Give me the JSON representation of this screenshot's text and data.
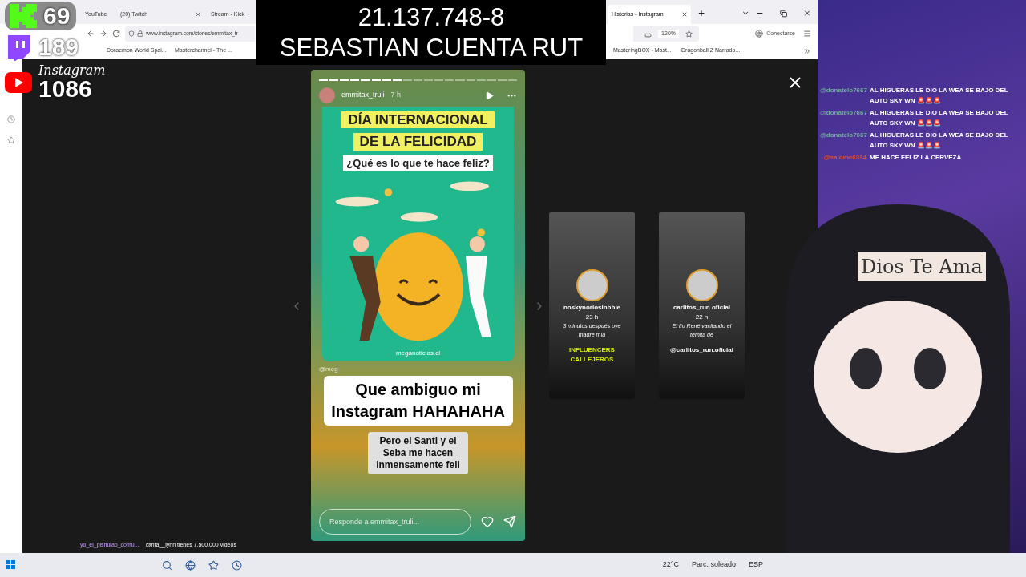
{
  "overlay": {
    "rut": "21.137.748-8",
    "title": "SEBASTIAN CUENTA RUT"
  },
  "counters": [
    {
      "kind": "kick",
      "value": "69"
    },
    {
      "kind": "twitch",
      "value": "189"
    },
    {
      "kind": "youtube",
      "label": "Instagram",
      "value": "1086"
    }
  ],
  "browser": {
    "tabs": [
      {
        "label": "YouTube",
        "selected": false
      },
      {
        "label": "(20) Twitch",
        "selected": false
      },
      {
        "label": "Stream - Kick",
        "selected": false
      },
      {
        "label": "Historias • Instagram",
        "selected": true
      }
    ],
    "url": "www.instagram.com/stories/emmitax_tr",
    "zoom": "120%",
    "sign_in": "Conectarse",
    "bookmarks": [
      "Doraemon World Spai...",
      "Masterchannel - The ...",
      "MasteringBOX - Mast...",
      "Dragonball Z Narrado..."
    ]
  },
  "story": {
    "segments": [
      {
        "seen": true
      },
      {
        "seen": true
      },
      {
        "seen": true
      },
      {
        "seen": true
      },
      {
        "seen": true
      },
      {
        "seen": true
      },
      {
        "seen": true
      },
      {
        "seen": true
      },
      {
        "seen": false
      },
      {
        "seen": false
      },
      {
        "seen": false
      },
      {
        "seen": false
      },
      {
        "seen": false
      },
      {
        "seen": false
      },
      {
        "seen": false
      },
      {
        "seen": false
      },
      {
        "seen": false
      },
      {
        "seen": false
      },
      {
        "seen": false
      }
    ],
    "username": "emmitax_truli",
    "time": "7 h",
    "headline": [
      "DÍA INTERNACIONAL",
      "DE LA FELICIDAD"
    ],
    "question": "¿Qué es lo que te hace feliz?",
    "source": "meganoticias.cl",
    "mention": "@meg",
    "caption": "Que ambiguo mi Instagram HAHAHAHA",
    "subcaption": "Pero el Santi y el Seba me hacen inmensamente feli",
    "reply_placeholder": "Responde a emmitax_truli..."
  },
  "next_stories": [
    {
      "username": "noskynoriosinbbie",
      "time": "23 h",
      "caption": "3 minutos después oye madre mía",
      "tag": "INFLUENCERS CALLEJEROS"
    },
    {
      "username": "carlitos_run.oficial",
      "time": "22 h",
      "caption": "El tío René vacilando el temita de",
      "tag": "@carlitos_run.oficial"
    }
  ],
  "chat": [
    {
      "user": "@donatelo7667",
      "message": "AL HIGUERAS LE DIO LA WEA SE BAJO DEL AUTO SKY WN 🚨🚨🚨",
      "color": "#6fae9a"
    },
    {
      "user": "@donatelo7667",
      "message": "AL HIGUERAS LE DIO LA WEA SE BAJO DEL AUTO SKY WN 🚨🚨🚨",
      "color": "#6fae9a"
    },
    {
      "user": "@donatelo7667",
      "message": "AL HIGUERAS LE DIO LA WEA SE BAJO DEL AUTO SKY WN 🚨🚨🚨",
      "color": "#6fae9a"
    },
    {
      "user": "@salome6334",
      "message": "ME HACE FELIZ LA CERVEZA",
      "color": "#e0502a"
    }
  ],
  "avatar_text": "Dios Te Ama",
  "bottom_chat": [
    {
      "user": "yo_el_pishulao_comu...",
      "message": "@rita__lynn tienes 7.500.000 videos"
    }
  ],
  "taskbar": {
    "temperature": "22°C",
    "weather": "Parc. soleado",
    "language": "ESP"
  }
}
